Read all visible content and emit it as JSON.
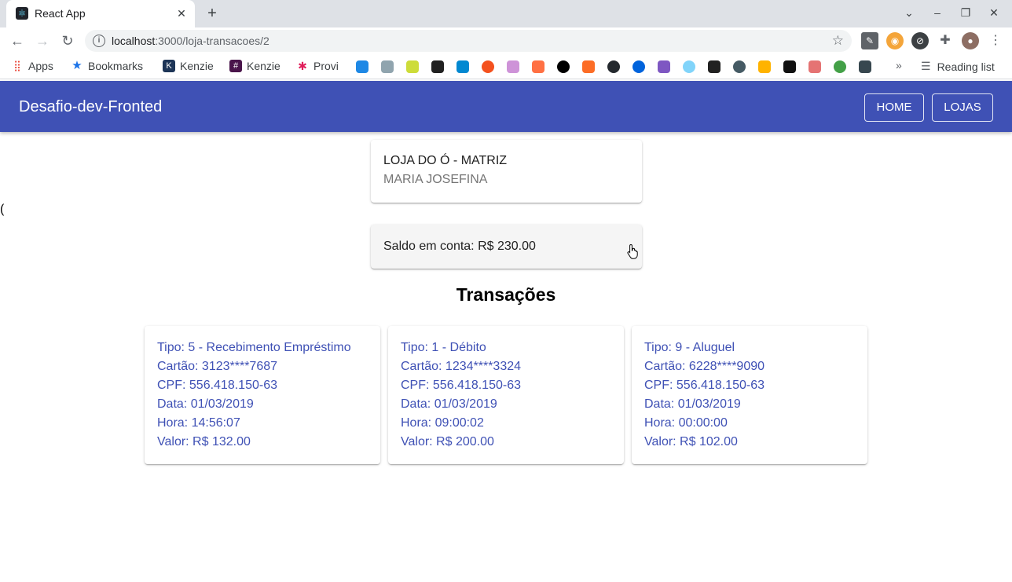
{
  "browser": {
    "tab_title": "React App",
    "url_host": "localhost",
    "url_path": ":3000/loja-transacoes/2",
    "bookmarks": {
      "apps": "Apps",
      "bookmarks": "Bookmarks",
      "kenzie1": "Kenzie",
      "kenzie2": "Kenzie",
      "provi": "Provi",
      "more": "»",
      "reading_list": "Reading list"
    }
  },
  "appbar": {
    "title": "Desafio-dev-Fronted",
    "home_label": "HOME",
    "lojas_label": "LOJAS",
    "color": "#3f51b5"
  },
  "stray_text": "(",
  "store": {
    "name": "LOJA DO Ó - MATRIZ",
    "owner": "MARIA JOSEFINA"
  },
  "balance": {
    "text": "Saldo em conta: R$ 230.00"
  },
  "transactions_title": "Transações",
  "transactions": [
    {
      "tipo": "Tipo: 5 - Recebimento Empréstimo",
      "cartao": "Cartão: 3123****7687",
      "cpf": "CPF: 556.418.150-63",
      "data": "Data: 01/03/2019",
      "hora": "Hora: 14:56:07",
      "valor": "Valor: R$ 132.00"
    },
    {
      "tipo": "Tipo: 1 - Débito",
      "cartao": "Cartão: 1234****3324",
      "cpf": "CPF: 556.418.150-63",
      "data": "Data: 01/03/2019",
      "hora": "Hora: 09:00:02",
      "valor": "Valor: R$ 200.00"
    },
    {
      "tipo": "Tipo: 9 - Aluguel",
      "cartao": "Cartão: 6228****9090",
      "cpf": "CPF: 556.418.150-63",
      "data": "Data: 01/03/2019",
      "hora": "Hora: 00:00:00",
      "valor": "Valor: R$ 102.00"
    }
  ]
}
